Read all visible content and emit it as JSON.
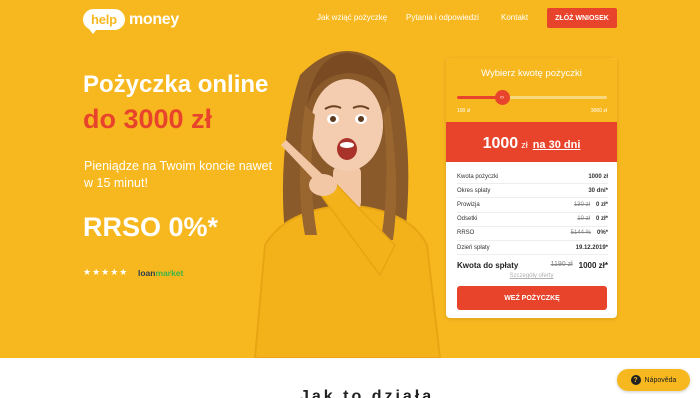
{
  "brand": {
    "bubble": "help",
    "word": "money",
    "color": "#f7b81f"
  },
  "nav": [
    {
      "label": "Jak wziąć pożyczkę"
    },
    {
      "label": "Pytania i odpowiedzi"
    },
    {
      "label": "Kontakt"
    }
  ],
  "header_cta": "ZŁÓŻ WNIOSEK",
  "hero": {
    "title_line1": "Pożyczka online",
    "title_line2": "do 3000 zł",
    "subtitle": "Pieniądze na Twoim koncie nawet w 15 minut!",
    "rrso": "RRSO 0%*",
    "rating_stars": "★★★★★",
    "rating_brand_a": "loan",
    "rating_brand_b": "market"
  },
  "calculator": {
    "title": "Wybierz kwotę pożyczki",
    "slider_value": 0.3,
    "slider_min": "100 zł",
    "slider_max": "3000 zł",
    "amount": "1000",
    "currency": "zł",
    "period": "na 30 dni",
    "rows": [
      {
        "label": "Kwota pożyczki",
        "old": "",
        "value": "1000 zł"
      },
      {
        "label": "Okres spłaty",
        "old": "",
        "value": "30 dni*"
      },
      {
        "label": "Prowizja",
        "old": "130 zł",
        "value": "0 zł*"
      },
      {
        "label": "Odsetki",
        "old": "10 zł",
        "value": "0 zł*"
      },
      {
        "label": "RRSO",
        "old": "5144 %",
        "value": "0%*"
      },
      {
        "label": "Dzień spłaty",
        "old": "",
        "value": "19.12.2019*"
      }
    ],
    "total_label": "Kwota do spłaty",
    "total_old": "1190 zł",
    "total_value": "1000 zł*",
    "details_link": "Szczegóły oferty",
    "cta": "WEŹ POŻYCZKĘ"
  },
  "below_fold_partial": "Jak to działa",
  "help_widget": {
    "icon": "?",
    "label": "Nápověda"
  },
  "colors": {
    "accent": "#e8442b",
    "yellow": "#f7b81f"
  }
}
